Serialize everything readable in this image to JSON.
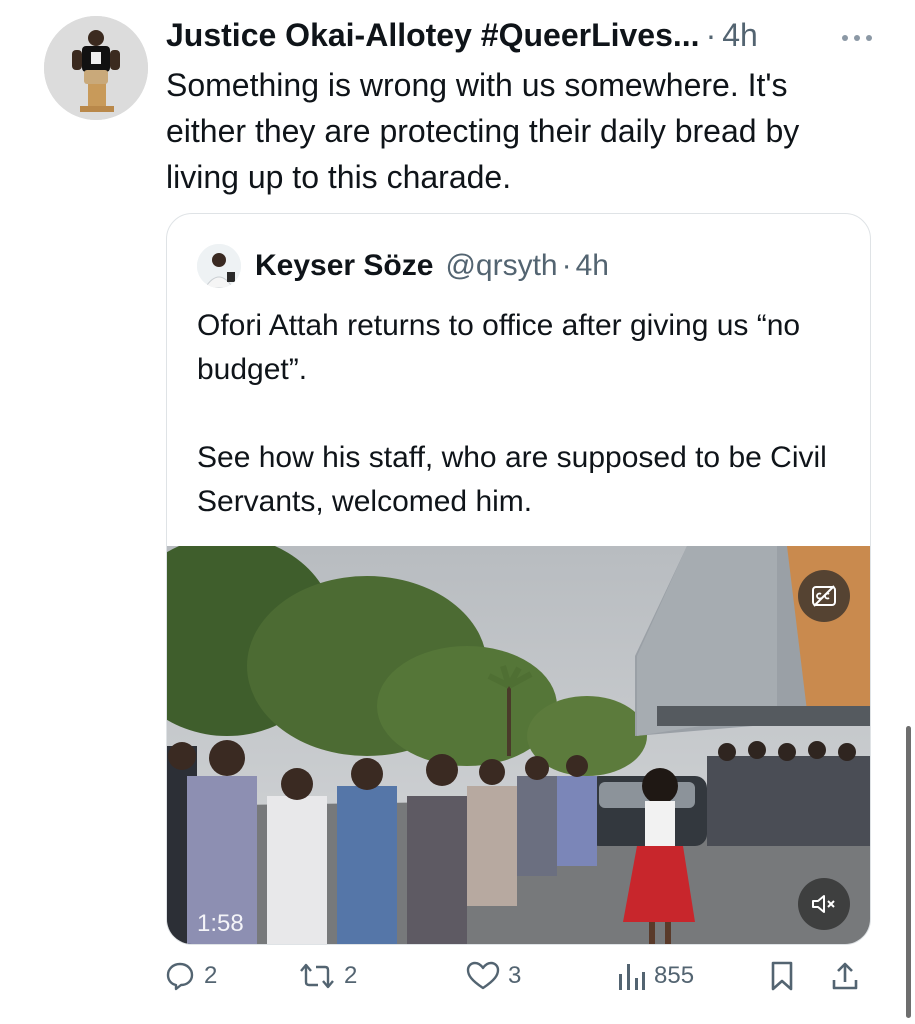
{
  "tweet": {
    "author": {
      "name": "Justice Okai-Allotey #QueerLives...",
      "separator": "·",
      "time": "4h"
    },
    "more_icon": "more-horizontal-icon",
    "text": "Something is wrong with us somewhere. It's either they are protecting their daily bread by living up to this charade."
  },
  "quote": {
    "name": "Keyser Söze",
    "handle": "@qrsyth",
    "separator": "·",
    "time": "4h",
    "paragraphs": [
      "Ofori Attah returns to office after giving us “no budget”.",
      "See how his staff, who are supposed to be Civil Servants, welcomed him."
    ],
    "media": {
      "duration": "1:58",
      "cc_icon": "closed-captions-off-icon",
      "mute_icon": "speaker-muted-icon"
    }
  },
  "actions": {
    "replies": {
      "icon": "reply-icon",
      "count": "2"
    },
    "reposts": {
      "icon": "repost-icon",
      "count": "2"
    },
    "likes": {
      "icon": "heart-icon",
      "count": "3"
    },
    "views": {
      "icon": "views-chart-icon",
      "count": "855"
    },
    "bookmark": {
      "icon": "bookmark-icon"
    },
    "share": {
      "icon": "share-icon"
    }
  },
  "colors": {
    "text": "#0f1419",
    "muted": "#536471",
    "border": "#dfe3e6"
  }
}
